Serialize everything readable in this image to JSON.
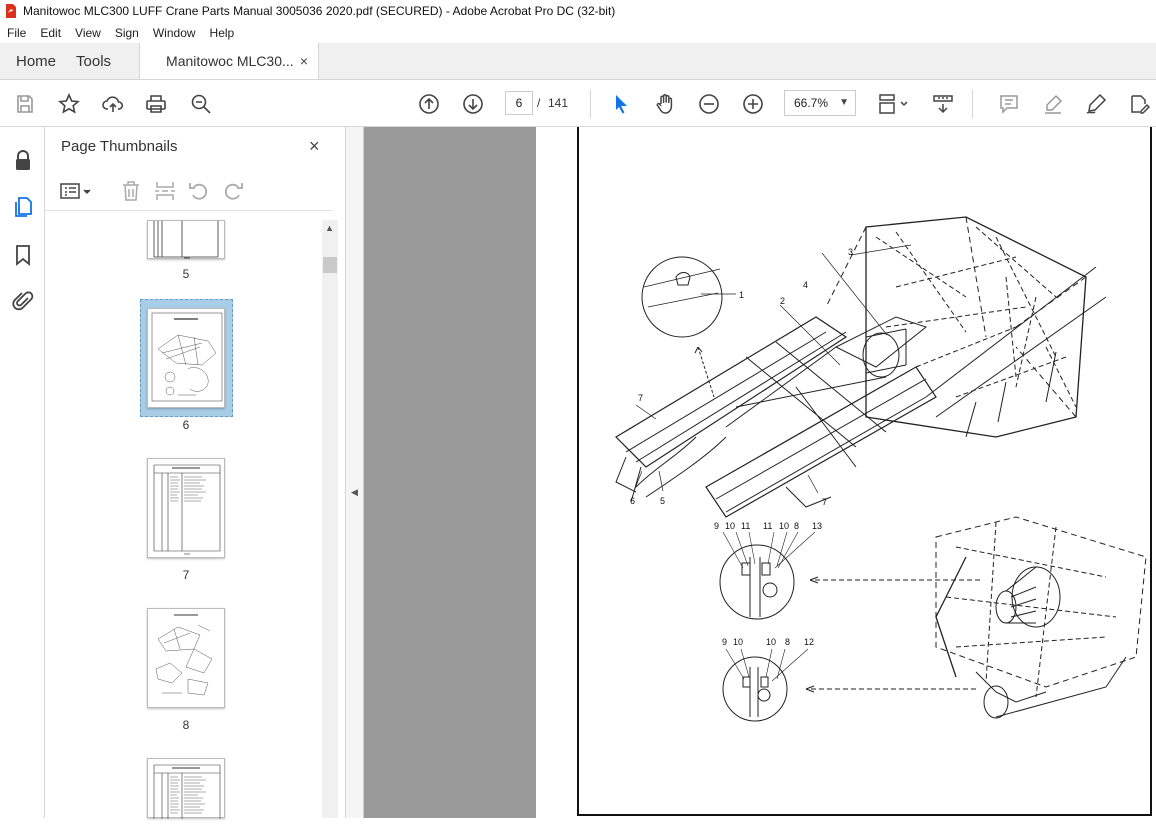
{
  "window": {
    "title": "Manitowoc MLC300 LUFF Crane Parts Manual 3005036 2020.pdf (SECURED) - Adobe Acrobat Pro DC (32-bit)"
  },
  "menu": [
    "File",
    "Edit",
    "View",
    "Sign",
    "Window",
    "Help"
  ],
  "tabs": {
    "home": "Home",
    "tools": "Tools",
    "document": "Manitowoc MLC30...",
    "close": "×"
  },
  "toolbar": {
    "current_page": "6",
    "page_sep": "/",
    "page_count": "141",
    "zoom": "66.7%"
  },
  "panel": {
    "title": "Page Thumbnails",
    "close": "×",
    "thumbnails": [
      {
        "label": "5"
      },
      {
        "label": "6",
        "selected": true
      },
      {
        "label": "7"
      },
      {
        "label": "8"
      },
      {
        "label": ""
      }
    ]
  },
  "drawing": {
    "callouts": [
      "1",
      "2",
      "3",
      "4",
      "7",
      "6",
      "5",
      "7"
    ],
    "detail_a": [
      "9",
      "10",
      "11",
      "11",
      "10",
      "8",
      "13"
    ],
    "detail_b": [
      "9",
      "10",
      "10",
      "8",
      "12"
    ]
  },
  "colors": {
    "accent": "#1473e6",
    "doc_bg": "#9a9a9a",
    "selection": "#a8cde6",
    "pdf_icon": "#d9321d"
  }
}
